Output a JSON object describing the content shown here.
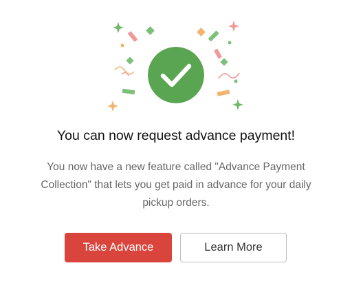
{
  "dialog": {
    "title": "You can now request advance payment!",
    "description": "You now have a new feature called \"Advance Payment Collection\" that lets you get paid in advance for your daily pickup orders.",
    "primary_button_label": "Take Advance",
    "secondary_button_label": "Learn More"
  },
  "illustration": {
    "badge_icon": "checkmark-icon",
    "decoration": "confetti"
  },
  "colors": {
    "badge_green": "#5aa552",
    "primary_red": "#d9453d",
    "confetti_green": "#7cc07a",
    "confetti_pink": "#ee9a9a",
    "confetti_orange": "#f2b36e"
  }
}
